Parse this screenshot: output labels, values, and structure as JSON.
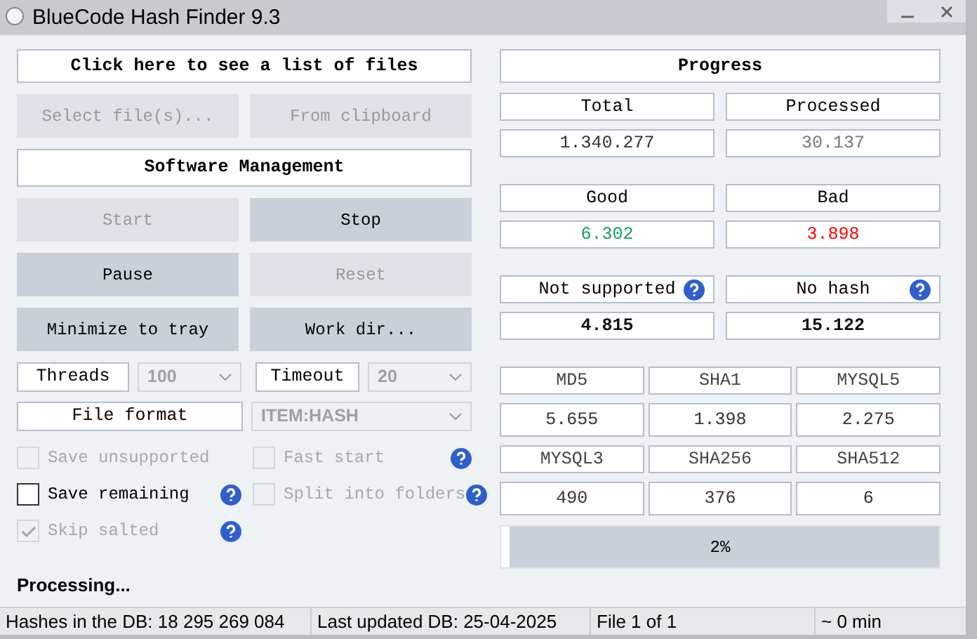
{
  "window": {
    "title": "BlueCode Hash Finder 9.3"
  },
  "file_list_button": "Click here to see a list of files",
  "source_buttons": [
    {
      "label": "Select file(s)...",
      "disabled": true
    },
    {
      "label": "From clipboard",
      "disabled": true
    }
  ],
  "software_management": "Software Management",
  "control_buttons": [
    {
      "label": "Start",
      "disabled": true
    },
    {
      "label": "Stop",
      "disabled": false
    },
    {
      "label": "Pause",
      "disabled": false
    },
    {
      "label": "Reset",
      "disabled": true
    },
    {
      "label": "Minimize to tray",
      "disabled": false
    },
    {
      "label": "Work dir...",
      "disabled": false
    }
  ],
  "threads": {
    "label": "Threads",
    "value": "100",
    "disabled": true
  },
  "timeout": {
    "label": "Timeout",
    "value": "20",
    "disabled": true
  },
  "file_format": {
    "label": "File format",
    "value": "ITEM:HASH",
    "disabled": true
  },
  "options_left": [
    {
      "label": "Save unsupported",
      "checked": false,
      "disabled": true,
      "help": false
    },
    {
      "label": "Save remaining",
      "checked": false,
      "disabled": false,
      "help": true
    },
    {
      "label": "Skip salted",
      "checked": true,
      "disabled": true,
      "help": true
    }
  ],
  "options_right": [
    {
      "label": "Fast start",
      "checked": false,
      "disabled": true,
      "help": true
    },
    {
      "label": "Split into folders",
      "checked": false,
      "disabled": true,
      "help": true
    }
  ],
  "status_text": "Processing...",
  "progress": {
    "title": "Progress",
    "stat_groups": [
      [
        {
          "label": "Total",
          "value": "1.340.277",
          "color": "#333333",
          "help": false
        },
        {
          "label": "Processed",
          "value": "30.137",
          "color": "#777777",
          "help": false
        }
      ],
      [
        {
          "label": "Good",
          "value": "6.302",
          "color": "#13a05a",
          "help": false
        },
        {
          "label": "Bad",
          "value": "3.898",
          "color": "#ff0000",
          "help": false
        }
      ],
      [
        {
          "label": "Not supported",
          "value": "4.815",
          "color": "#111111",
          "help": true
        },
        {
          "label": "No hash",
          "value": "15.122",
          "color": "#111111",
          "help": true
        }
      ]
    ],
    "hash_types": [
      {
        "label": "MD5",
        "value": "5.655"
      },
      {
        "label": "SHA1",
        "value": "1.398"
      },
      {
        "label": "MYSQL5",
        "value": "2.275"
      },
      {
        "label": "MYSQL3",
        "value": "490"
      },
      {
        "label": "SHA256",
        "value": "376"
      },
      {
        "label": "SHA512",
        "value": "6"
      }
    ],
    "level": 0.02,
    "reading": "2%"
  },
  "status_bar": [
    "Hashes in the DB: 18 295 269 084",
    "Last updated DB: 25-04-2025",
    "File 1 of 1",
    "~ 0 min"
  ]
}
